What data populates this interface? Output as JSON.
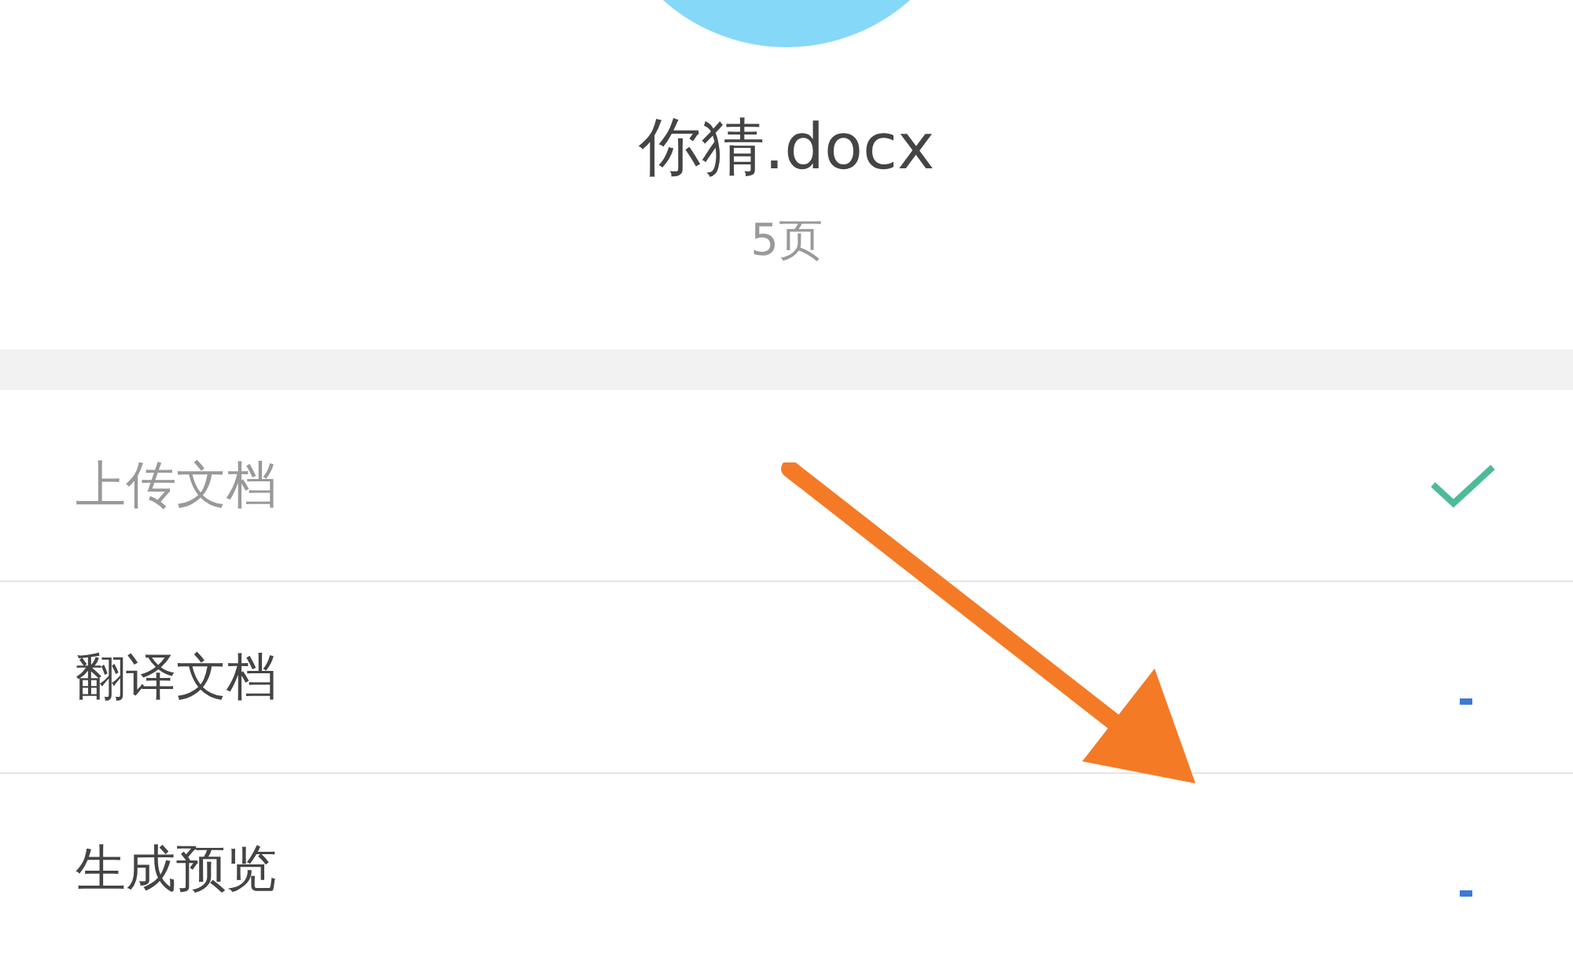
{
  "file": {
    "name": "你猜.docx",
    "pages": "5页"
  },
  "steps": [
    {
      "label": "上传文档",
      "done": true
    },
    {
      "label": "翻译文档",
      "done": false
    },
    {
      "label": "生成预览",
      "done": false
    }
  ]
}
